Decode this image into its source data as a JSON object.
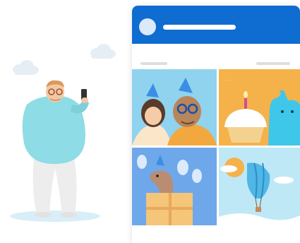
{
  "illustration": {
    "colors": {
      "header": "#0f6cd1",
      "tile_family": "#8fd3ee",
      "tile_birthday": "#f5b24a",
      "tile_dog": "#6ea8ea",
      "tile_balloon": "#bfe8f6",
      "person_shirt": "#8ddce6",
      "person_pants": "#eeeeee",
      "cloud": "#e6eef5"
    },
    "icons": [
      "avatar-icon",
      "cupcake-icon",
      "cat-icon",
      "dog-icon",
      "hot-air-balloon-icon",
      "person-with-phone-icon"
    ]
  }
}
